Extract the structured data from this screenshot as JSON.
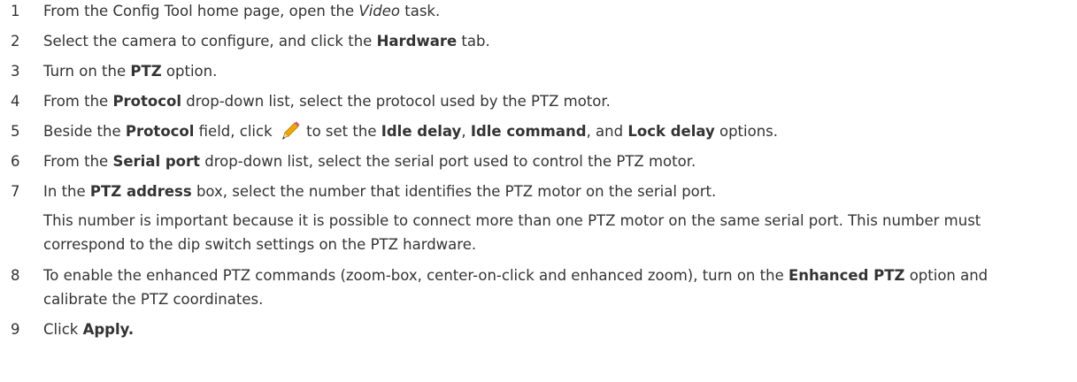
{
  "steps": [
    {
      "num": "1",
      "t1": "From the Config Tool home page, open the ",
      "i1": "Video",
      "t2": " task."
    },
    {
      "num": "2",
      "t1": "Select the camera to configure, and click the ",
      "b1": "Hardware",
      "t2": " tab."
    },
    {
      "num": "3",
      "t1": "Turn on the ",
      "b1": "PTZ",
      "t2": " option."
    },
    {
      "num": "4",
      "t1": "From the ",
      "b1": "Protocol",
      "t2": " drop-down list, select the protocol used by the PTZ motor."
    },
    {
      "num": "5",
      "t1": "Beside the ",
      "b1": "Protocol",
      "t2": " field, click ",
      "t3": " to set the ",
      "b2": "Idle delay",
      "t4": ", ",
      "b3": "Idle command",
      "t5": ", and ",
      "b4": "Lock delay",
      "t6": " options."
    },
    {
      "num": "6",
      "t1": "From the ",
      "b1": "Serial port",
      "t2": " drop-down list, select the serial port used to control the PTZ motor."
    },
    {
      "num": "7",
      "t1": "In the ",
      "b1": "PTZ address",
      "t2": " box, select the number that identifies the PTZ motor on the serial port.",
      "note": "This number is important because it is possible to connect more than one PTZ motor on the same serial port. This number must correspond to the dip switch settings on the PTZ hardware."
    },
    {
      "num": "8",
      "t1": "To enable the enhanced PTZ commands (zoom-box, center-on-click and enhanced zoom), turn on the ",
      "b1": "Enhanced PTZ",
      "t2": " option and calibrate the PTZ coordinates."
    },
    {
      "num": "9",
      "t1": "Click ",
      "b1": "Apply."
    }
  ],
  "icons": {
    "pencil": "pencil-icon",
    "pencil_color": "#f0a800"
  }
}
